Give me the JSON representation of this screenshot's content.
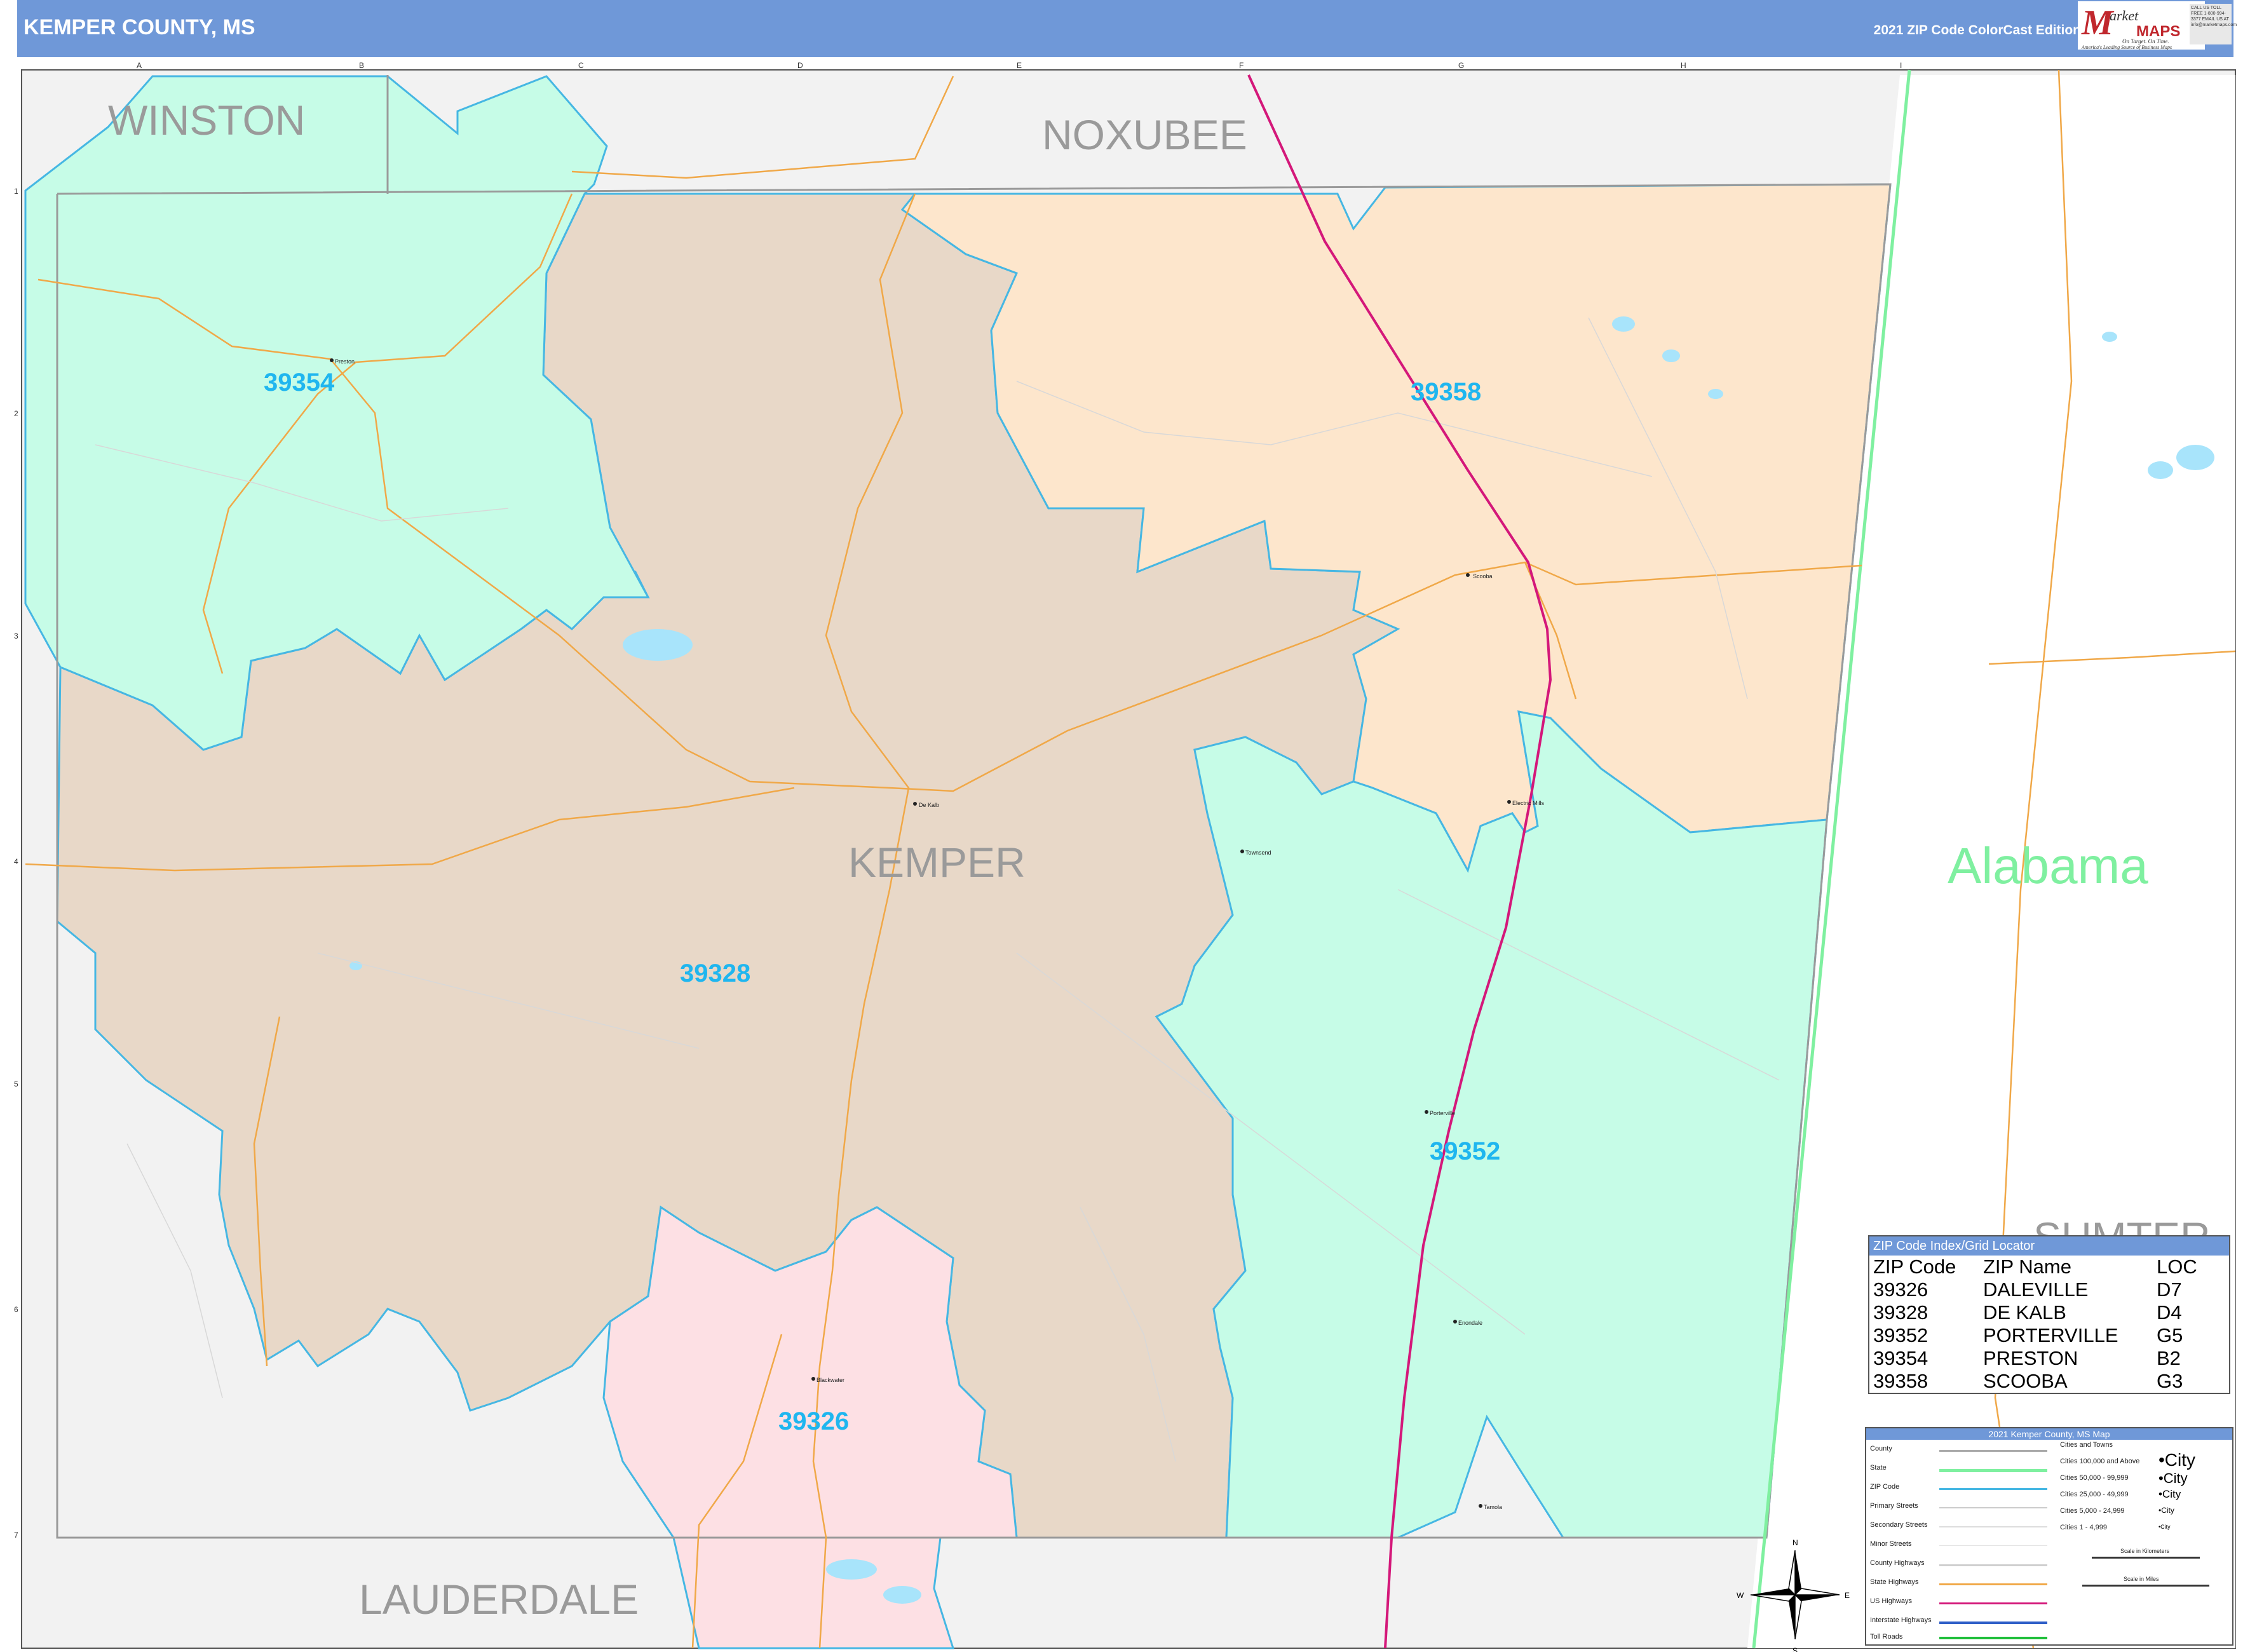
{
  "header": {
    "title": "KEMPER COUNTY, MS",
    "edition": "2021 ZIP Code ColorCast Edition",
    "logo": {
      "m": "M",
      "arket": "arket",
      "maps": "MAPS",
      "tagline1": "On Target. On Time.",
      "tagline2": "America's Leading Source of Business Maps",
      "contact": "CALL US TOLL FREE 1-800-994-3377 EMAIL US AT info@marketmaps.com"
    }
  },
  "map": {
    "colors": {
      "zip_39328": "#e8d8c8",
      "zip_39358": "#fde6cc",
      "zip_39354": "#c6fce7",
      "zip_39352": "#c6fce7",
      "zip_39326": "#fde0e4",
      "outside": "#f2f2f2",
      "zip_border": "#46b7e3",
      "zip_label": "#1fb6ef",
      "state_border": "#7ff0a0",
      "interstate": "#d4187a",
      "primary_road": "#f0a848",
      "water": "#a8e4fb"
    },
    "grid_columns": [
      "A",
      "B",
      "C",
      "D",
      "E",
      "F",
      "G",
      "H",
      "I"
    ],
    "grid_rows": [
      "1",
      "2",
      "3",
      "4",
      "5",
      "6",
      "7"
    ],
    "county_labels": [
      {
        "name": "WINSTON"
      },
      {
        "name": "NOXUBEE"
      },
      {
        "name": "KEMPER"
      },
      {
        "name": "LAUDERDALE"
      },
      {
        "name": "SUMTER"
      }
    ],
    "state_label": "Alabama",
    "zip_labels": [
      "39354",
      "39358",
      "39328",
      "39352",
      "39326"
    ],
    "towns": [
      "Preston",
      "Scooba",
      "De Kalb",
      "Electric Mills",
      "Townsend",
      "Porterville",
      "Blackwater",
      "Enondale",
      "Tamola"
    ],
    "compass": {
      "n": "N",
      "s": "S",
      "e": "E",
      "w": "W"
    }
  },
  "zip_index": {
    "title": "ZIP Code Index/Grid Locator",
    "headers": [
      "ZIP Code",
      "ZIP Name",
      "LOC"
    ],
    "rows": [
      [
        "39326",
        "DALEVILLE",
        "D7"
      ],
      [
        "39328",
        "DE KALB",
        "D4"
      ],
      [
        "39352",
        "PORTERVILLE",
        "G5"
      ],
      [
        "39354",
        "PRESTON",
        "B2"
      ],
      [
        "39358",
        "SCOOBA",
        "G3"
      ]
    ]
  },
  "legend": {
    "title": "2021 Kemper County, MS Map",
    "left_items": [
      "County",
      "State",
      "ZIP Code",
      "Primary Streets",
      "Secondary Streets",
      "Minor Streets",
      "County Highways",
      "State Highways",
      "US Highways",
      "Interstate Highways",
      "Toll Roads"
    ],
    "cities_heading": "Cities and Towns",
    "city_items": [
      {
        "label": "Cities 100,000 and Above",
        "sample": "•City"
      },
      {
        "label": "Cities 50,000 - 99,999",
        "sample": "•City"
      },
      {
        "label": "Cities 25,000 - 49,999",
        "sample": "•City"
      },
      {
        "label": "Cities 5,000 - 24,999",
        "sample": "•City"
      },
      {
        "label": "Cities 1 - 4,999",
        "sample": "•City"
      }
    ],
    "scale_km": "Scale in Kilometers",
    "scale_miles": "Scale in Miles"
  }
}
